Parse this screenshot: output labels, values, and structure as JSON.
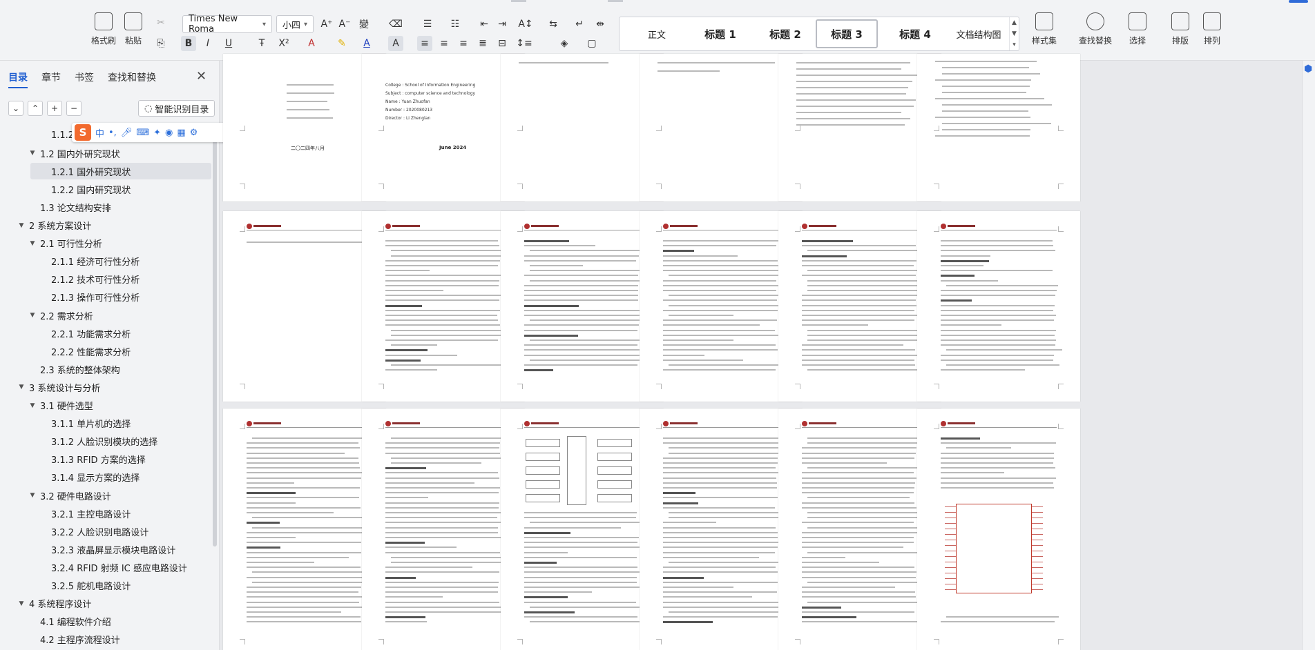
{
  "ribbon": {
    "format_painter": "格式刷",
    "paste": "粘贴",
    "font_name": "Times New Roma",
    "font_size": "小四",
    "styles": [
      "正文",
      "标题 1",
      "标题 2",
      "标题 3",
      "标题 4",
      "文档结构图"
    ],
    "style_set": "样式集",
    "find_replace": "查找替换",
    "select": "选择",
    "arrange_text": "排版",
    "arrange": "排列"
  },
  "sidebar": {
    "tabs": [
      "目录",
      "章节",
      "书签",
      "查找和替换"
    ],
    "smart_toc": "智能识别目录",
    "ime_logo": "S",
    "ime_lang": "中",
    "toc": [
      {
        "label": "1.1.2",
        "level": 3,
        "arrow": ""
      },
      {
        "label": "1.2  国内外研究现状",
        "level": 2,
        "arrow": "▼"
      },
      {
        "label": "1.2.1  国外研究现状",
        "level": 3,
        "arrow": "",
        "active": true
      },
      {
        "label": "1.2.2  国内研究现状",
        "level": 3,
        "arrow": ""
      },
      {
        "label": "1.3  论文结构安排",
        "level": 2,
        "arrow": ""
      },
      {
        "label": "2  系统方案设计",
        "level": 1,
        "arrow": "▼"
      },
      {
        "label": "2.1  可行性分析",
        "level": 2,
        "arrow": "▼"
      },
      {
        "label": "2.1.1  经济可行性分析",
        "level": 3,
        "arrow": ""
      },
      {
        "label": "2.1.2  技术可行性分析",
        "level": 3,
        "arrow": ""
      },
      {
        "label": "2.1.3  操作可行性分析",
        "level": 3,
        "arrow": ""
      },
      {
        "label": "2.2  需求分析",
        "level": 2,
        "arrow": "▼"
      },
      {
        "label": "2.2.1  功能需求分析",
        "level": 3,
        "arrow": ""
      },
      {
        "label": "2.2.2  性能需求分析",
        "level": 3,
        "arrow": ""
      },
      {
        "label": "2.3  系统的整体架构",
        "level": 2,
        "arrow": ""
      },
      {
        "label": "3  系统设计与分析",
        "level": 1,
        "arrow": "▼"
      },
      {
        "label": "3.1  硬件选型",
        "level": 2,
        "arrow": "▼"
      },
      {
        "label": "3.1.1  单片机的选择",
        "level": 3,
        "arrow": ""
      },
      {
        "label": "3.1.2  人脸识别模块的选择",
        "level": 3,
        "arrow": ""
      },
      {
        "label": "3.1.3  RFID 方案的选择",
        "level": 3,
        "arrow": ""
      },
      {
        "label": "3.1.4  显示方案的选择",
        "level": 3,
        "arrow": ""
      },
      {
        "label": "3.2  硬件电路设计",
        "level": 2,
        "arrow": "▼"
      },
      {
        "label": "3.2.1  主控电路设计",
        "level": 3,
        "arrow": ""
      },
      {
        "label": "3.2.2  人脸识别电路设计",
        "level": 3,
        "arrow": ""
      },
      {
        "label": "3.2.3  液晶屏显示模块电路设计",
        "level": 3,
        "arrow": ""
      },
      {
        "label": "3.2.4  RFID 射频 IC 感应电路设计",
        "level": 3,
        "arrow": ""
      },
      {
        "label": "3.2.5  舵机电路设计",
        "level": 3,
        "arrow": ""
      },
      {
        "label": "4  系统程序设计",
        "level": 1,
        "arrow": "▼"
      },
      {
        "label": "4.1  编程软件介绍",
        "level": 2,
        "arrow": ""
      },
      {
        "label": "4.2  主程序流程设计",
        "level": 2,
        "arrow": ""
      }
    ]
  },
  "pages": {
    "cover_cn_date": "二〇二四年八月",
    "cover_en_date": "June 2024",
    "cover_en_lines": [
      "College  :  School of Information Engineering",
      "Subject  :  computer science and technology",
      "Name  :  Yuan Zhuofan",
      "Number  :  2020080213",
      "Director  :  Li Zhenglan"
    ]
  }
}
